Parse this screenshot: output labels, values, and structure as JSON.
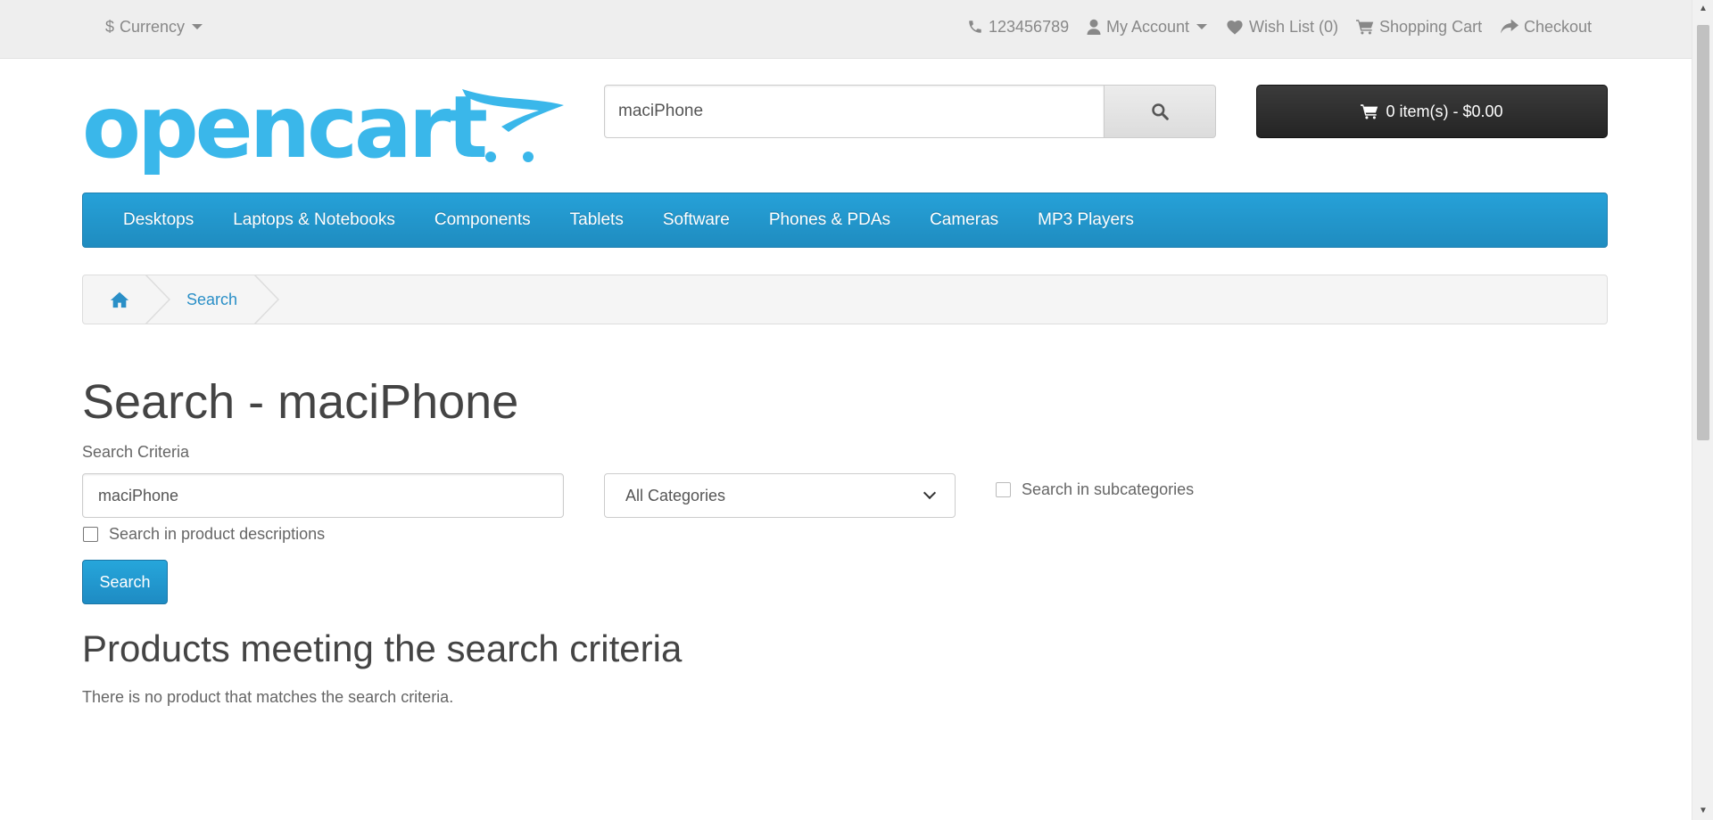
{
  "topbar": {
    "currency_label": "Currency",
    "phone": "123456789",
    "my_account": "My Account",
    "wishlist": "Wish List (0)",
    "shopping_cart": "Shopping Cart",
    "checkout": "Checkout"
  },
  "header": {
    "logo_text": "opencart",
    "search_value": "maciPhone",
    "cart_label": "0 item(s) - $0.00"
  },
  "menu": {
    "items": [
      "Desktops",
      "Laptops & Notebooks",
      "Components",
      "Tablets",
      "Software",
      "Phones & PDAs",
      "Cameras",
      "MP3 Players"
    ]
  },
  "breadcrumb": {
    "current": "Search"
  },
  "content": {
    "title": "Search - maciPhone",
    "criteria_label": "Search Criteria",
    "criteria_value": "maciPhone",
    "category_selected": "All Categories",
    "subcategories_label": "Search in subcategories",
    "descriptions_label": "Search in product descriptions",
    "search_button": "Search",
    "results_heading": "Products meeting the search criteria",
    "no_results": "There is no product that matches the search criteria."
  },
  "colors": {
    "brand_blue": "#229ac8",
    "logo_blue": "#3ab7ea",
    "cart_dark": "#303030"
  }
}
